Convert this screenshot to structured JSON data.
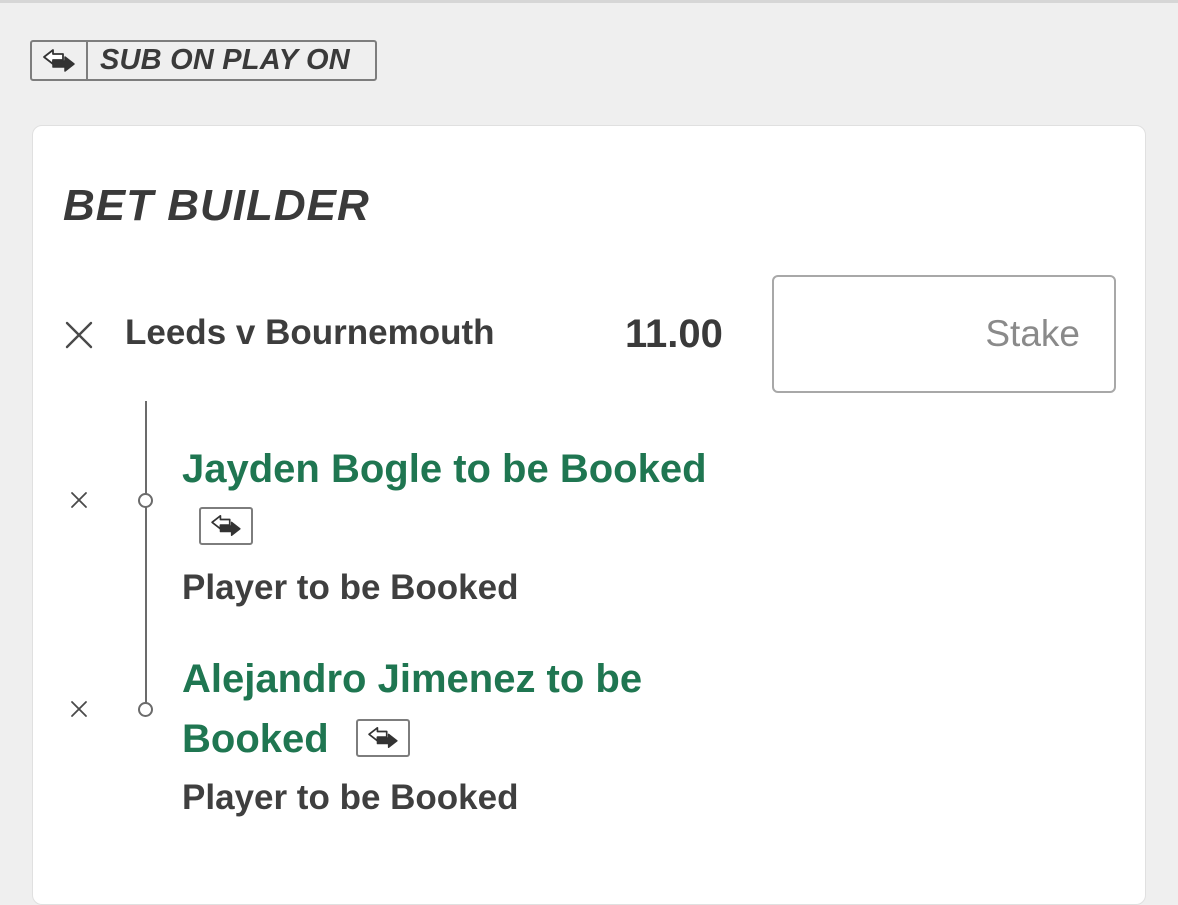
{
  "sub_on_badge": {
    "label": "SUB ON PLAY ON",
    "icon": "sub-swap-icon"
  },
  "bet_builder": {
    "title": "BET BUILDER",
    "event": "Leeds v Bournemouth",
    "odds": "11.00",
    "stake_placeholder": "Stake",
    "legs": [
      {
        "selection": "Jayden Bogle to be Booked",
        "market": "Player to be Booked",
        "icon": "sub-swap-icon"
      },
      {
        "selection_line1": "Alejandro Jimenez to be",
        "selection_line2": "Booked",
        "market": "Player to be Booked",
        "icon": "sub-swap-icon"
      }
    ]
  },
  "colors": {
    "accent_green": "#1f7651",
    "text_dark": "#3f3f3f",
    "background": "#efefef"
  }
}
